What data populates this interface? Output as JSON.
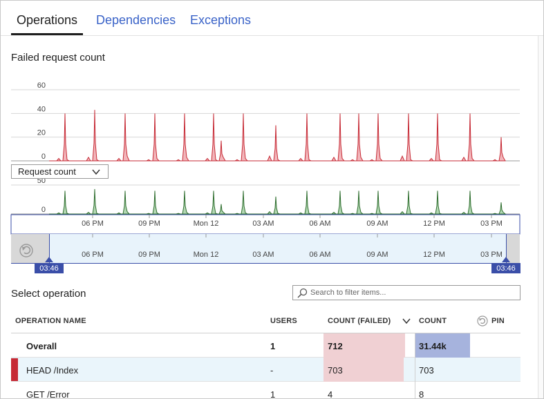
{
  "tabs": [
    {
      "label": "Operations",
      "active": true
    },
    {
      "label": "Dependencies",
      "active": false
    },
    {
      "label": "Exceptions",
      "active": false
    }
  ],
  "failed_chart": {
    "title": "Failed request count",
    "y_ticks": [
      "60",
      "40",
      "20",
      "0"
    ]
  },
  "metric_dropdown": {
    "selected": "Request count"
  },
  "request_chart": {
    "y_ticks": [
      "50",
      "0"
    ]
  },
  "x_ticks": [
    "06 PM",
    "09 PM",
    "Mon 12",
    "03 AM",
    "06 AM",
    "09 AM",
    "12 PM",
    "03 PM"
  ],
  "range_selector": {
    "start_label": "03:46",
    "end_label": "03:46"
  },
  "operations": {
    "title": "Select operation",
    "search_placeholder": "Search to filter items...",
    "columns": {
      "name": "OPERATION NAME",
      "users": "USERS",
      "count_failed": "COUNT (FAILED)",
      "count": "COUNT",
      "pin": "PIN"
    },
    "rows": [
      {
        "name": "Overall",
        "users": "1",
        "count_failed": "712",
        "count": "31.44k",
        "failed_fraction": 1.0,
        "count_fraction": 1.0
      },
      {
        "name": "HEAD /Index",
        "users": "-",
        "count_failed": "703",
        "count": "703",
        "failed_fraction": 0.987
      },
      {
        "name": "GET /Error",
        "users": "1",
        "count_failed": "4",
        "count": "8"
      }
    ]
  },
  "chart_data": [
    {
      "type": "area",
      "title": "Failed request count",
      "ylim": [
        0,
        60
      ],
      "y_ticks": [
        0,
        20,
        40,
        60
      ],
      "x_ticks": [
        "06 PM",
        "09 PM",
        "Mon 12",
        "03 AM",
        "06 AM",
        "09 AM",
        "12 PM",
        "03 PM"
      ],
      "series": [
        {
          "color": "#c62a35",
          "peaks": [
            40,
            43,
            40,
            40,
            40,
            40,
            17,
            40,
            30,
            40,
            40,
            40,
            40,
            40,
            40,
            40,
            40,
            40,
            40,
            40,
            40,
            40,
            20
          ]
        }
      ]
    },
    {
      "type": "area",
      "title": "Request count",
      "ylim": [
        0,
        50
      ],
      "y_ticks": [
        0,
        50
      ],
      "x_ticks": [
        "06 PM",
        "09 PM",
        "Mon 12",
        "03 AM",
        "06 AM",
        "09 AM",
        "12 PM",
        "03 PM"
      ],
      "series": [
        {
          "color": "#3a7d3a",
          "peaks": [
            40,
            43,
            40,
            40,
            40,
            40,
            17,
            40,
            30,
            40,
            40,
            40,
            40,
            40,
            40,
            40,
            40,
            40,
            40,
            40,
            40,
            40,
            20
          ]
        }
      ]
    }
  ]
}
